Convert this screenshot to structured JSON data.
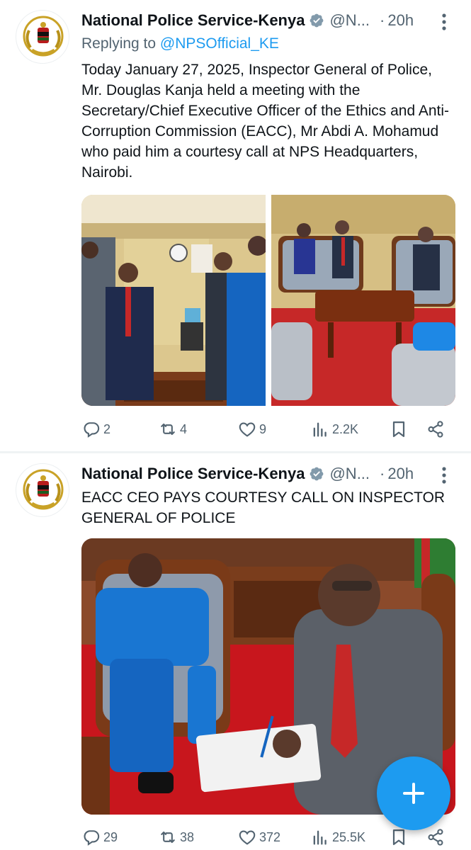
{
  "tweets": [
    {
      "author_name": "National Police Service-Kenya",
      "handle": "@N...",
      "separator": "·",
      "time": "20h",
      "reply_prefix": "Replying to",
      "reply_to": "@NPSOfficial_KE",
      "text": "Today January 27, 2025, Inspector General of Police, Mr. Douglas Kanja held a meeting with the Secretary/Chief Executive Officer of the Ethics and Anti-Corruption Commission (EACC), Mr Abdi A. Mohamud who paid him a courtesy call at NPS Headquarters, Nairobi.",
      "stats": {
        "replies": "2",
        "retweets": "4",
        "likes": "9",
        "views": "2.2K"
      }
    },
    {
      "author_name": "National Police Service-Kenya",
      "handle": "@N...",
      "separator": "·",
      "time": "20h",
      "text": "EACC CEO PAYS COURTESY CALL ON INSPECTOR GENERAL OF POLICE",
      "stats": {
        "replies": "29",
        "retweets": "38",
        "likes": "372",
        "views": "25.5K"
      }
    }
  ],
  "colors": {
    "accent": "#1d9bf0",
    "verified": "#829aab",
    "text_primary": "#0f1419",
    "text_secondary": "#536471"
  },
  "icons": [
    "verified-badge-icon",
    "more-options-icon",
    "reply-icon",
    "retweet-icon",
    "like-icon",
    "views-icon",
    "bookmark-icon",
    "share-icon",
    "compose-plus-icon"
  ]
}
